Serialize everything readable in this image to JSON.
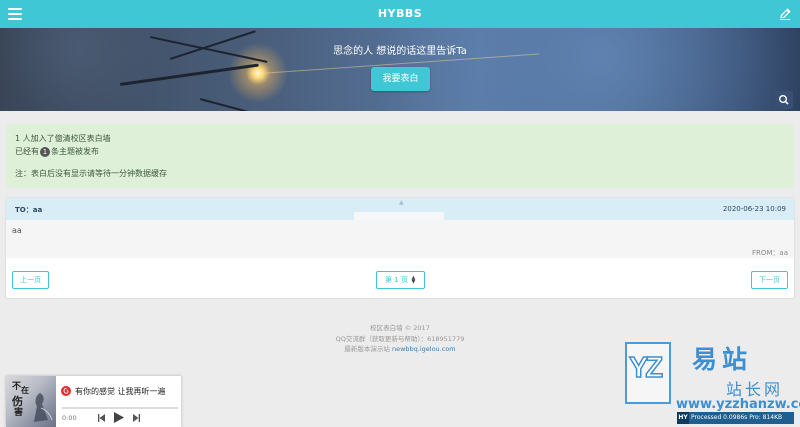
{
  "header": {
    "title": "HYBBS"
  },
  "hero": {
    "headline": "思念的人 想说的话这里告诉Ta",
    "confess_button": "我要表白"
  },
  "notice": {
    "line1": "1 人加入了億清校区表白墙",
    "line2_prefix": "已经有",
    "post_count": "1",
    "line2_suffix": "条主题被发布",
    "note": "注：表白后没有显示请等待一分钟数据缓存"
  },
  "post": {
    "to": "TO：aa",
    "date": "2020-06-23 10:09",
    "content": "aa",
    "from": "FROM：aa"
  },
  "pagination": {
    "prev_label": "上一页",
    "page_label": "第 1 页",
    "next_label": "下一页"
  },
  "footer": {
    "line1": "校区表白墙 © 2017",
    "line2": "QQ交流群（获取更新与帮助）：618951779",
    "line3_prefix": "最新版本演示站",
    "line3_link": "newbbq.igelou.com"
  },
  "player": {
    "song_title": "有你的感觉 让我再听一遍",
    "cover_text": [
      "不",
      "在",
      "伤",
      "害"
    ],
    "time": "0:00"
  },
  "watermark": {
    "letters": "YZ",
    "cn_top": "易站",
    "cn_bottom": "站长网",
    "url": "www.yzzhanzw.com",
    "badge_hy": "HY",
    "badge_text": "Processed 0.0986s  Pro: 814KB"
  },
  "colors": {
    "accent": "#3fc7d6",
    "notice_bg": "#dff0d8",
    "post_head_bg": "#d9edf7",
    "watermark": "#3d8fd0"
  },
  "icons": {
    "menu": "hamburger-menu-icon",
    "edit": "pencil-icon",
    "search": "search-icon",
    "music": "netease-music-icon",
    "prev_track": "skip-back-icon",
    "play": "play-icon",
    "next_track": "skip-forward-icon",
    "sort": "up-down-arrows-icon"
  }
}
